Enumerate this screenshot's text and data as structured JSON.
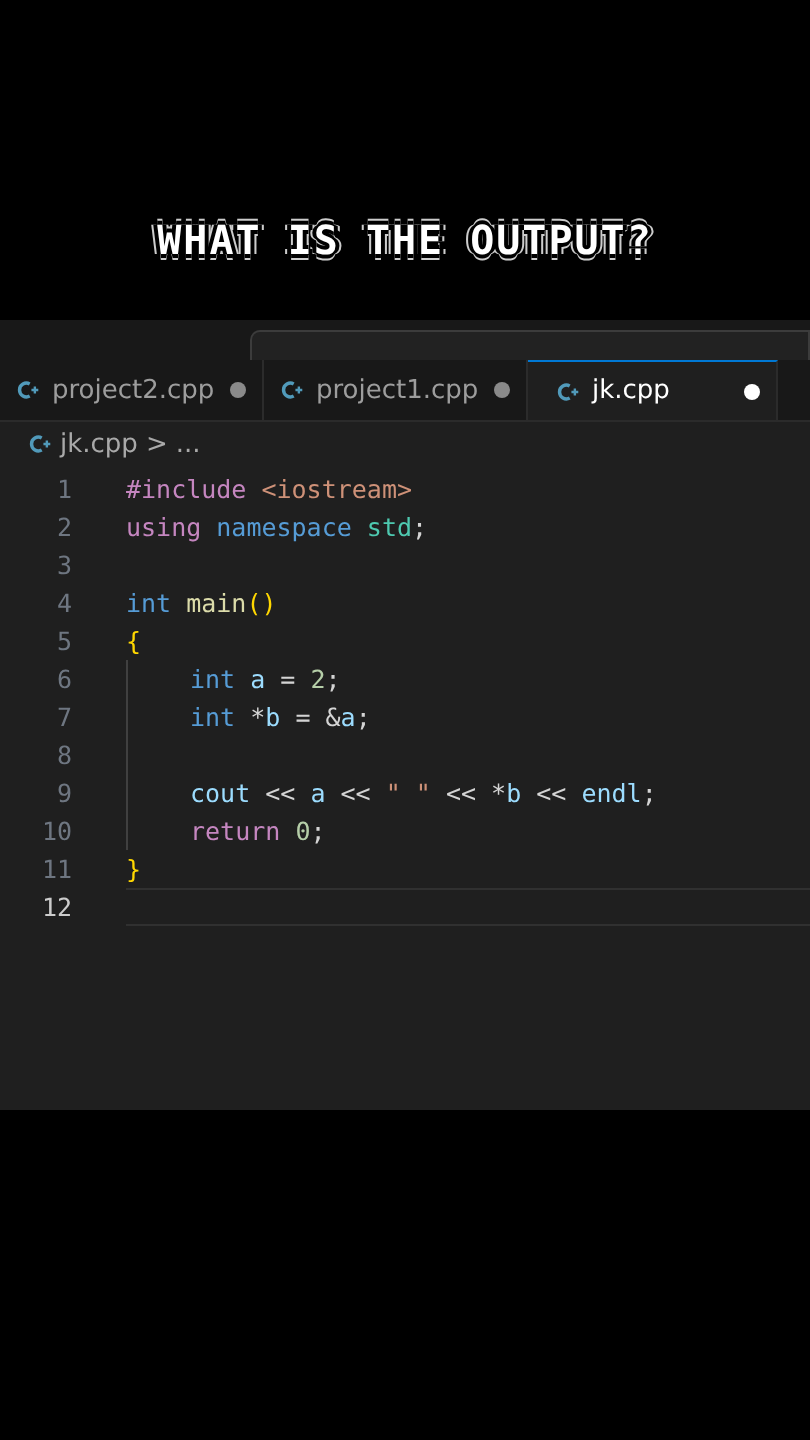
{
  "caption": "WHAT IS THE OUTPUT?",
  "tabs": [
    {
      "label": "project2.cpp",
      "selected": false,
      "modified": true
    },
    {
      "label": "project1.cpp",
      "selected": false,
      "modified": true
    },
    {
      "label": "jk.cpp",
      "selected": true,
      "modified": true
    }
  ],
  "breadcrumb": {
    "file": "jk.cpp",
    "separator": ">",
    "rest": "..."
  },
  "lines": [
    {
      "number": "1",
      "current": false,
      "indented": false,
      "tokens": [
        {
          "kind": "directive",
          "text": "#include "
        },
        {
          "kind": "string",
          "text": "<iostream>"
        }
      ]
    },
    {
      "number": "2",
      "current": false,
      "indented": false,
      "tokens": [
        {
          "kind": "control",
          "text": "using "
        },
        {
          "kind": "storage",
          "text": "namespace "
        },
        {
          "kind": "type",
          "text": "std"
        },
        {
          "kind": "plain",
          "text": ";"
        }
      ]
    },
    {
      "number": "3",
      "current": false
    },
    {
      "number": "4",
      "current": false,
      "indented": false,
      "tokens": [
        {
          "kind": "storage",
          "text": "int "
        },
        {
          "kind": "function",
          "text": "main"
        },
        {
          "kind": "bracket",
          "text": "()"
        }
      ]
    },
    {
      "number": "5",
      "current": false,
      "indented": false,
      "tokens": [
        {
          "kind": "bracket",
          "text": "{"
        }
      ]
    },
    {
      "number": "6",
      "current": false,
      "indented": true,
      "tokens": [
        {
          "kind": "storage",
          "text": "int "
        },
        {
          "kind": "variable",
          "text": "a"
        },
        {
          "kind": "plain",
          "text": " = "
        },
        {
          "kind": "number",
          "text": "2"
        },
        {
          "kind": "plain",
          "text": ";"
        }
      ]
    },
    {
      "number": "7",
      "current": false,
      "indented": true,
      "tokens": [
        {
          "kind": "storage",
          "text": "int "
        },
        {
          "kind": "plain",
          "text": "*"
        },
        {
          "kind": "variable",
          "text": "b"
        },
        {
          "kind": "plain",
          "text": " = &"
        },
        {
          "kind": "variable",
          "text": "a"
        },
        {
          "kind": "plain",
          "text": ";"
        }
      ]
    },
    {
      "number": "8",
      "current": false,
      "indented": true
    },
    {
      "number": "9",
      "current": false,
      "indented": true,
      "tokens": [
        {
          "kind": "variable",
          "text": "cout"
        },
        {
          "kind": "plain",
          "text": " << "
        },
        {
          "kind": "variable",
          "text": "a"
        },
        {
          "kind": "plain",
          "text": " << "
        },
        {
          "kind": "string",
          "text": "\" \""
        },
        {
          "kind": "plain",
          "text": " << *"
        },
        {
          "kind": "variable",
          "text": "b"
        },
        {
          "kind": "plain",
          "text": " << "
        },
        {
          "kind": "variable",
          "text": "endl"
        },
        {
          "kind": "plain",
          "text": ";"
        }
      ]
    },
    {
      "number": "10",
      "current": false,
      "indented": true,
      "tokens": [
        {
          "kind": "control",
          "text": "return "
        },
        {
          "kind": "number",
          "text": "0"
        },
        {
          "kind": "plain",
          "text": ";"
        }
      ]
    },
    {
      "number": "11",
      "current": false,
      "indented": false,
      "tokens": [
        {
          "kind": "bracket",
          "text": "}"
        }
      ]
    },
    {
      "number": "12",
      "current": true
    }
  ]
}
